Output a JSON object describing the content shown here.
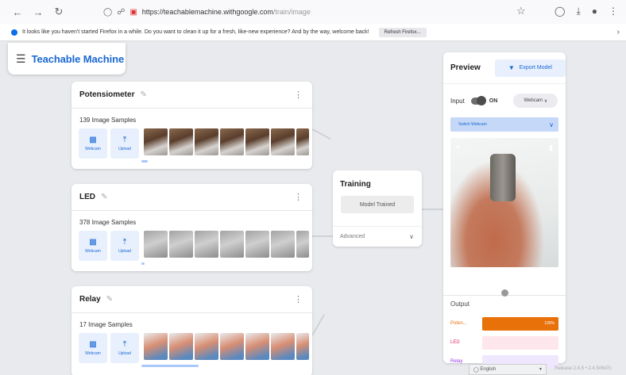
{
  "browser": {
    "url_host": "https://teachablemachine.withgoogle.com",
    "url_path": "/train/image",
    "notice_text": "It looks like you haven't started Firefox in a while. Do you want to clean it up for a fresh, like-new experience? And by the way, welcome back!",
    "notice_button": "Refresh Firefox..."
  },
  "app": {
    "title": "Teachable Machine"
  },
  "classes": [
    {
      "name": "Potensiometer",
      "samples": "139 Image Samples",
      "webcam": "Webcam",
      "upload": "Upload"
    },
    {
      "name": "LED",
      "samples": "378 Image Samples",
      "webcam": "Webcam",
      "upload": "Upload"
    },
    {
      "name": "Relay",
      "samples": "17 Image Samples",
      "webcam": "Webcam",
      "upload": "Upload"
    }
  ],
  "training": {
    "title": "Training",
    "button": "Model Trained",
    "advanced": "Advanced"
  },
  "preview": {
    "title": "Preview",
    "export": "Export Model",
    "input_label": "Input",
    "toggle_state": "ON",
    "source": "Webcam",
    "switch_webcam": "Switch Webcam",
    "output_label": "Output",
    "outputs": [
      {
        "label": "Poten...",
        "percent": "100%",
        "value": 1.0,
        "color": "#e8710a",
        "bg": "#e8710a"
      },
      {
        "label": "LED",
        "percent": "",
        "value": 0.0,
        "color": "#d93062",
        "bg": "#fde7ec"
      },
      {
        "label": "Relay",
        "percent": "",
        "value": 0.0,
        "color": "#9334e6",
        "bg": "#efe7fd"
      }
    ]
  },
  "footer": {
    "language": "English",
    "version": "Release 2.4.5 • 2.4.5#8d7c"
  },
  "colors": {
    "accent": "#1967d2",
    "accent_bg": "#e8f0fe",
    "app_bg": "#e8eaed"
  }
}
